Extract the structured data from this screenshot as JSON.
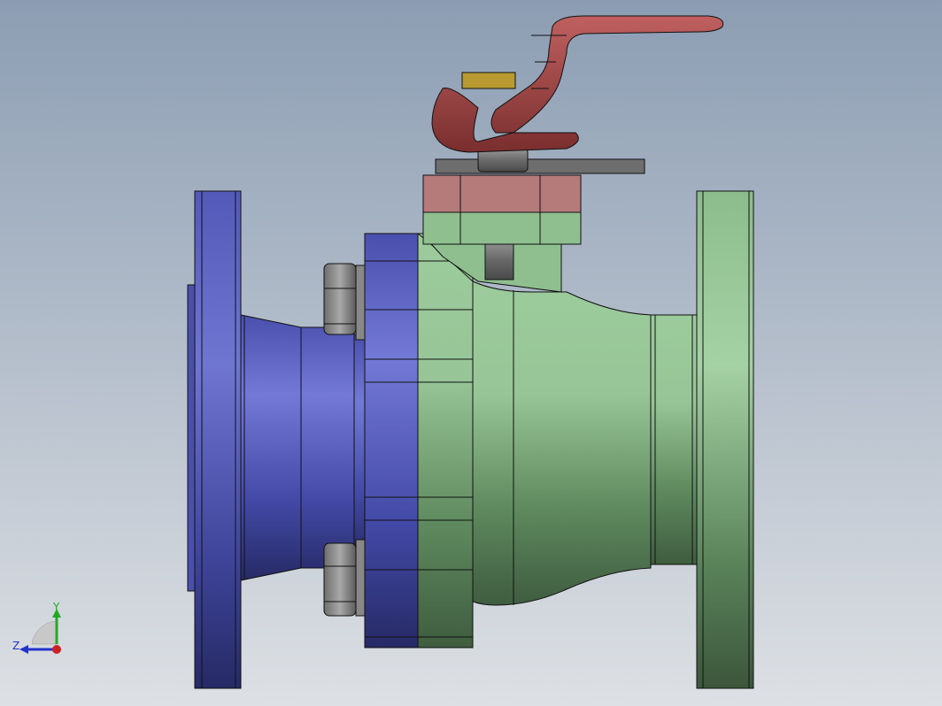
{
  "viewport": {
    "background_top": "#8c9db3",
    "background_bottom": "#dadde2"
  },
  "model": {
    "name": "ball-valve",
    "parts": [
      {
        "name": "left-flange",
        "color": "#5a5fc0"
      },
      {
        "name": "left-reducer-body",
        "color": "#5a5fc0"
      },
      {
        "name": "body-flange-left",
        "color": "#5a5fc0"
      },
      {
        "name": "main-body",
        "color": "#8fc08f"
      },
      {
        "name": "right-flange",
        "color": "#8fc08f"
      },
      {
        "name": "bonnet",
        "color": "#b87a7a"
      },
      {
        "name": "lever-handle",
        "color": "#b24a4a"
      },
      {
        "name": "stem-nut",
        "color": "#7a7a7a"
      },
      {
        "name": "stop-plate",
        "color": "#6e6e6e"
      },
      {
        "name": "gland",
        "color": "#c8a040"
      }
    ]
  },
  "triad": {
    "y_label": "Y",
    "z_label": "Z",
    "y_color": "#22aa22",
    "z_color": "#2233cc",
    "x_color": "#cc2222"
  }
}
